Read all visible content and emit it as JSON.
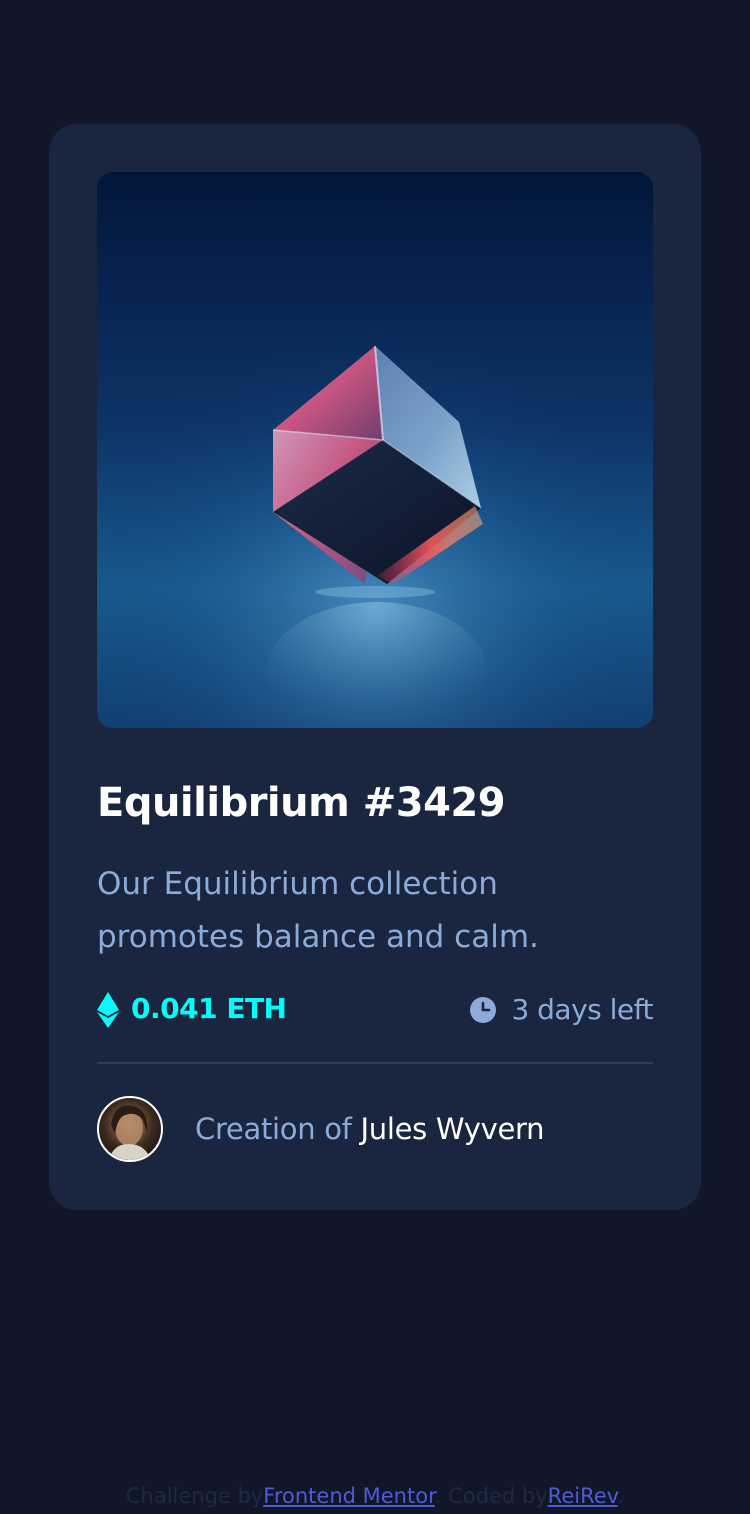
{
  "card": {
    "image_alt": "Equilibrium",
    "title": "Equilibrium #3429",
    "description": "Our Equilibrium collection promotes balance and calm.",
    "price": "0.041 ETH",
    "time_left": "3 days left",
    "creator_prefix": "Creation of ",
    "creator_name": "Jules Wyvern",
    "icons": {
      "price": "ethereum-icon",
      "time": "clock-icon"
    }
  },
  "footer": {
    "challenge_prefix": "Challenge by",
    "challenge_link": "Frontend Mentor",
    "coded_prefix": ". Coded by",
    "coded_link": "ReiRev",
    "suffix": "."
  },
  "colors": {
    "page_bg": "#111729",
    "card_bg": "#1a2540",
    "accent_cyan": "#00fff8",
    "soft_blue": "#8bacd9",
    "white": "#ffffff",
    "link": "#4f5bd5"
  }
}
